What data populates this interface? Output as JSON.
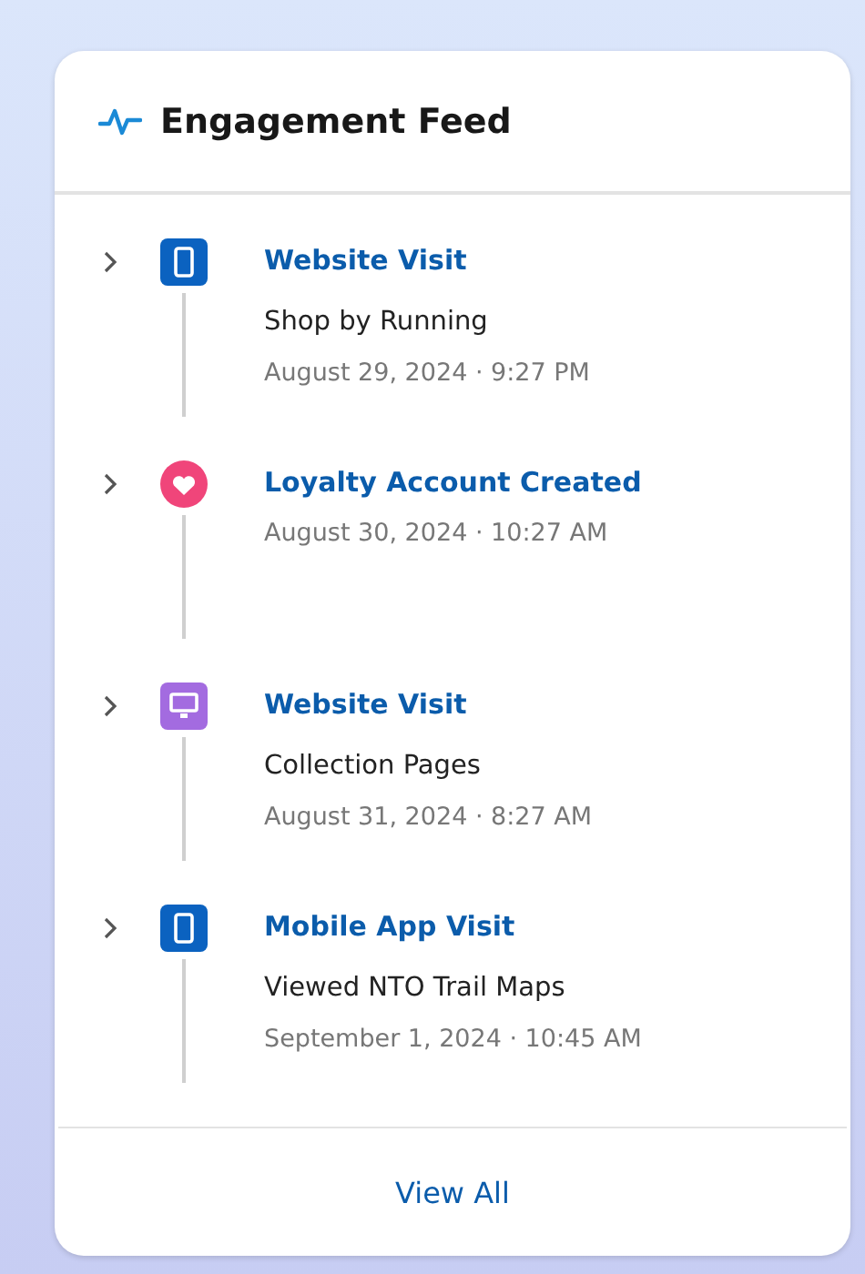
{
  "card": {
    "title": "Engagement Feed"
  },
  "events": [
    {
      "kind": "mobile",
      "title": "Website Visit",
      "detail": "Shop by Running",
      "time": "August 29, 2024 · 9:27 PM"
    },
    {
      "kind": "loyalty",
      "title": "Loyalty Account Created",
      "time": "August 30, 2024 · 10:27 AM"
    },
    {
      "kind": "desktop",
      "title": "Website Visit",
      "detail": "Collection Pages",
      "time": "August 31, 2024 · 8:27 AM"
    },
    {
      "kind": "mobile",
      "title": "Mobile App Visit",
      "detail": "Viewed NTO Trail Maps",
      "time": "September 1, 2024 · 10:45 AM"
    }
  ],
  "footer": {
    "link": "View All"
  }
}
